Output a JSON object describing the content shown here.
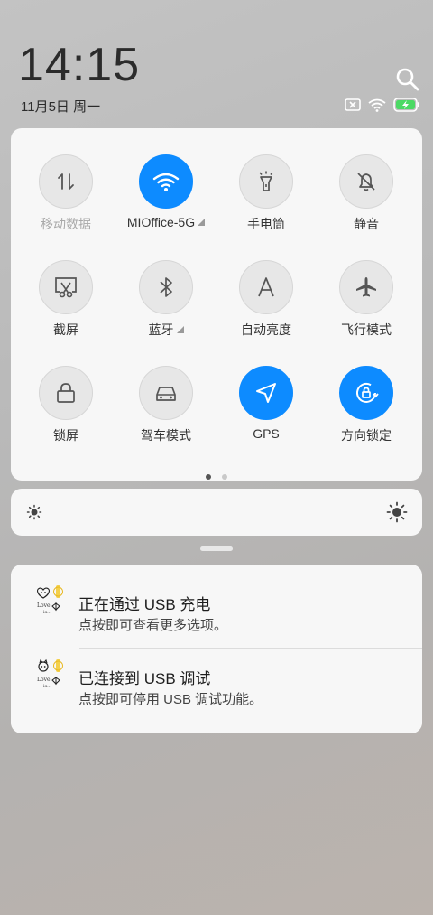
{
  "status": {
    "time": "14:15",
    "date": "11月5日 周一"
  },
  "tiles": [
    {
      "label": "移动数据",
      "icon": "mobile-data-icon",
      "active": false,
      "dim": true
    },
    {
      "label": "MIOffice-5G",
      "icon": "wifi-icon",
      "active": true,
      "dim": false,
      "more": true
    },
    {
      "label": "手电筒",
      "icon": "flashlight-icon",
      "active": false,
      "dim": false
    },
    {
      "label": "静音",
      "icon": "mute-bell-icon",
      "active": false,
      "dim": false
    },
    {
      "label": "截屏",
      "icon": "screenshot-icon",
      "active": false,
      "dim": false
    },
    {
      "label": "蓝牙",
      "icon": "bluetooth-icon",
      "active": false,
      "dim": false,
      "more": true
    },
    {
      "label": "自动亮度",
      "icon": "auto-brightness-icon",
      "active": false,
      "dim": false
    },
    {
      "label": "飞行模式",
      "icon": "airplane-icon",
      "active": false,
      "dim": false
    },
    {
      "label": "锁屏",
      "icon": "lock-icon",
      "active": false,
      "dim": false
    },
    {
      "label": "驾车模式",
      "icon": "car-icon",
      "active": false,
      "dim": false
    },
    {
      "label": "GPS",
      "icon": "gps-arrow-icon",
      "active": true,
      "dim": false
    },
    {
      "label": "方向锁定",
      "icon": "rotation-lock-icon",
      "active": true,
      "dim": false
    }
  ],
  "pager": {
    "pages": 2,
    "current": 1
  },
  "notifications": [
    {
      "title": "正在通过 USB 充电",
      "subtitle": "点按即可查看更多选项。"
    },
    {
      "title": "已连接到 USB 调试",
      "subtitle": "点按即可停用 USB 调试功能。"
    }
  ],
  "colors": {
    "accent": "#0d8bff",
    "panel": "#f7f7f7",
    "battery_charge": "#4cd964"
  }
}
